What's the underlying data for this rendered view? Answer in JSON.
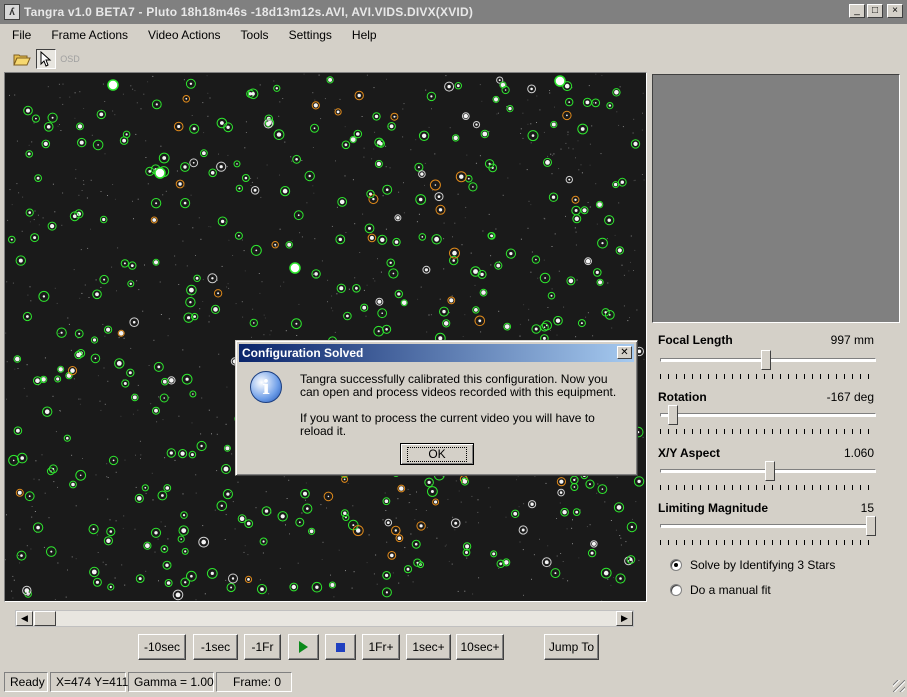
{
  "window": {
    "app_icon": "tangra-icon",
    "title": "Tangra v1.0 BETA7 - Pluto 18h18m46s -18d13m12s.AVI, AVI.VIDS.DIVX(XVID)",
    "controls": {
      "minimize": "_",
      "maximize": "□",
      "close": "×"
    }
  },
  "menu": [
    "File",
    "Frame Actions",
    "Video Actions",
    "Tools",
    "Settings",
    "Help"
  ],
  "toolbar": {
    "open_icon": "folder-open-icon",
    "pointer_icon": "pointer-icon",
    "disabled_label": "OSD"
  },
  "playback": {
    "minus10sec": "-10sec",
    "minus1sec": "-1sec",
    "minus1fr": "-1Fr",
    "play_icon": "play-icon",
    "stop_icon": "stop-icon",
    "plus1fr": "1Fr+",
    "plus1sec": "1sec+",
    "plus10sec": "10sec+",
    "jump_to": "Jump To"
  },
  "calibration": {
    "focal_length": {
      "label": "Focal Length",
      "value": "997 mm",
      "level": 0.49
    },
    "rotation": {
      "label": "Rotation",
      "value": "-167 deg",
      "level": 0.04
    },
    "aspect": {
      "label": "X/Y Aspect",
      "value": "1.060",
      "level": 0.51
    },
    "limiting_magnitude": {
      "label": "Limiting Magnitude",
      "value": "15",
      "level": 1.0
    },
    "options": [
      {
        "label": "Solve by Identifying 3 Stars",
        "selected": true
      },
      {
        "label": "Do a manual fit",
        "selected": false
      }
    ]
  },
  "status": {
    "state": "Ready",
    "coords": "X=474 Y=411",
    "gamma": "Gamma = 1.00",
    "frame": "Frame: 0"
  },
  "dialog": {
    "title": "Configuration Solved",
    "icon": "info-icon",
    "line1": "Tangra successfully calibrated this configuration. Now you can open and process videos recorded with this equipment.",
    "line2": "If you want to process the current video you will have to reload it.",
    "ok": "OK"
  },
  "colors": {
    "matched_star": "#2ee62e",
    "unmatched_star": "#e08a1a",
    "faint_star": "#d0d0d0",
    "background": "#1a1a1a"
  }
}
